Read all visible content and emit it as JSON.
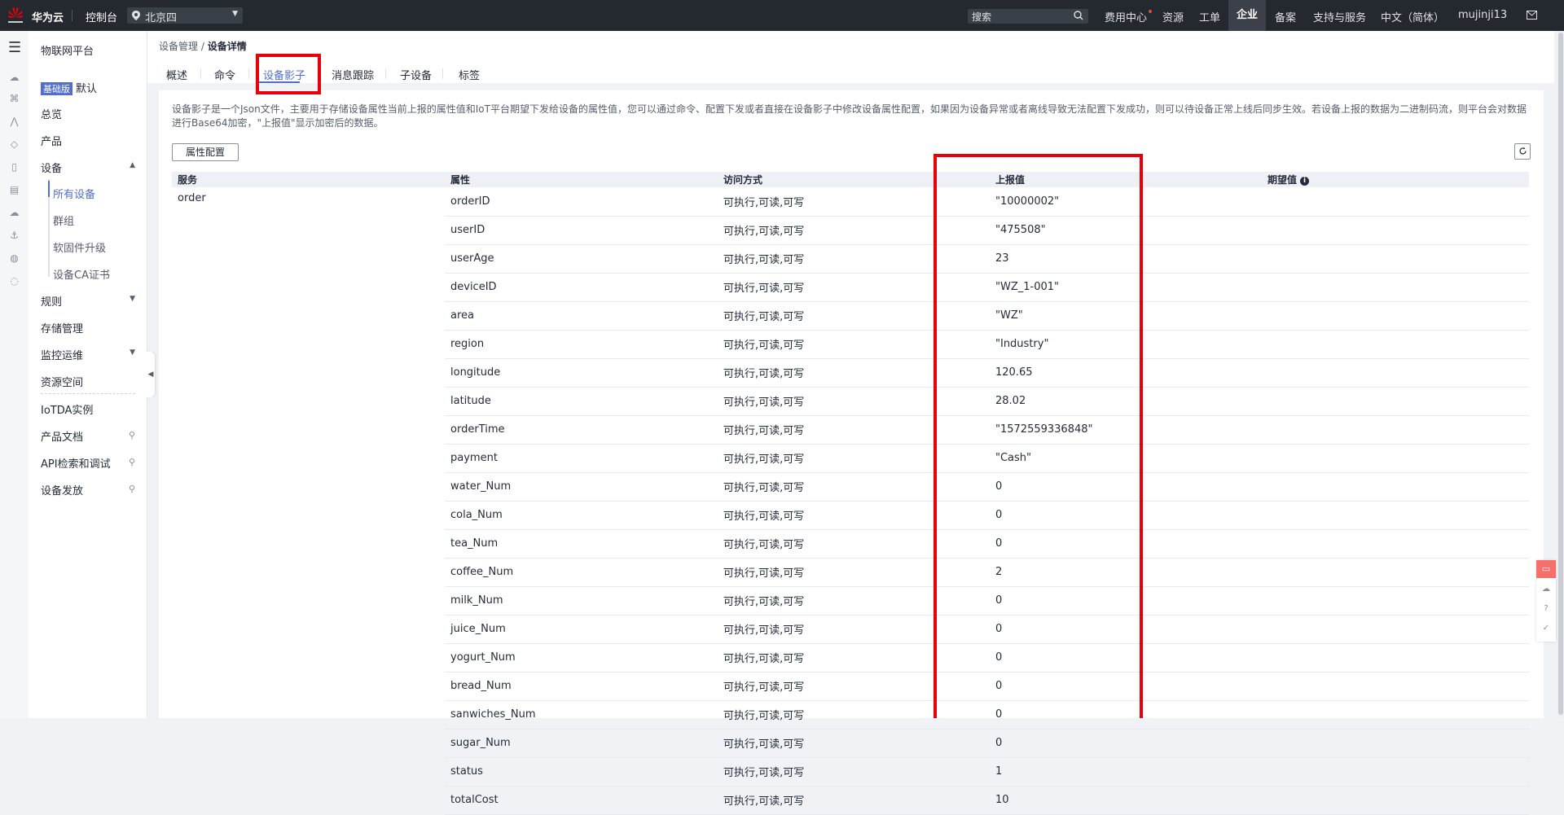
{
  "topbar": {
    "brand": "华为云",
    "console": "控制台",
    "region": "北京四",
    "search_placeholder": "搜索",
    "nav": [
      "费用中心",
      "资源",
      "工单",
      "企业",
      "备案",
      "支持与服务",
      "中文（简体）",
      "mujinji13"
    ],
    "active_nav": "企业"
  },
  "sidebar": {
    "title": "物联网平台",
    "edition_badge": "基础版",
    "edition_label": "默认",
    "items": [
      "总览",
      "产品",
      "设备",
      "规则",
      "存储管理",
      "监控运维",
      "资源空间",
      "IoTDA实例",
      "产品文档",
      "API检索和调试",
      "设备发放"
    ],
    "device_sub": [
      "所有设备",
      "群组",
      "软固件升级",
      "设备CA证书"
    ]
  },
  "breadcrumb": {
    "parent": "设备管理",
    "sep": " / ",
    "current": "设备详情"
  },
  "tabs": [
    "概述",
    "命令",
    "设备影子",
    "消息跟踪",
    "子设备",
    "标签"
  ],
  "active_tab": "设备影子",
  "description": "设备影子是一个Json文件，主要用于存储设备属性当前上报的属性值和IoT平台期望下发给设备的属性值，您可以通过命令、配置下发或者直接在设备影子中修改设备属性配置，如果因为设备异常或者离线导致无法配置下发成功，则可以待设备正常上线后同步生效。若设备上报的数据为二进制码流，则平台会对数据进行Base64加密，\"上报值\"显示加密后的数据。",
  "buttons": {
    "attr_config": "属性配置"
  },
  "table": {
    "headers": [
      "服务",
      "属性",
      "访问方式",
      "上报值",
      "期望值"
    ],
    "service": "order",
    "rows": [
      {
        "prop": "orderID",
        "access": "可执行,可读,可写",
        "reported": "\"10000002\""
      },
      {
        "prop": "userID",
        "access": "可执行,可读,可写",
        "reported": "\"475508\""
      },
      {
        "prop": "userAge",
        "access": "可执行,可读,可写",
        "reported": "23"
      },
      {
        "prop": "deviceID",
        "access": "可执行,可读,可写",
        "reported": "\"WZ_1-001\""
      },
      {
        "prop": "area",
        "access": "可执行,可读,可写",
        "reported": "\"WZ\""
      },
      {
        "prop": "region",
        "access": "可执行,可读,可写",
        "reported": "\"Industry\""
      },
      {
        "prop": "longitude",
        "access": "可执行,可读,可写",
        "reported": "120.65"
      },
      {
        "prop": "latitude",
        "access": "可执行,可读,可写",
        "reported": "28.02"
      },
      {
        "prop": "orderTime",
        "access": "可执行,可读,可写",
        "reported": "\"1572559336848\""
      },
      {
        "prop": "payment",
        "access": "可执行,可读,可写",
        "reported": "\"Cash\""
      },
      {
        "prop": "water_Num",
        "access": "可执行,可读,可写",
        "reported": "0"
      },
      {
        "prop": "cola_Num",
        "access": "可执行,可读,可写",
        "reported": "0"
      },
      {
        "prop": "tea_Num",
        "access": "可执行,可读,可写",
        "reported": "0"
      },
      {
        "prop": "coffee_Num",
        "access": "可执行,可读,可写",
        "reported": "2"
      },
      {
        "prop": "milk_Num",
        "access": "可执行,可读,可写",
        "reported": "0"
      },
      {
        "prop": "juice_Num",
        "access": "可执行,可读,可写",
        "reported": "0"
      },
      {
        "prop": "yogurt_Num",
        "access": "可执行,可读,可写",
        "reported": "0"
      },
      {
        "prop": "bread_Num",
        "access": "可执行,可读,可写",
        "reported": "0"
      },
      {
        "prop": "sanwiches_Num",
        "access": "可执行,可读,可写",
        "reported": "0"
      },
      {
        "prop": "sugar_Num",
        "access": "可执行,可读,可写",
        "reported": "0"
      },
      {
        "prop": "status",
        "access": "可执行,可读,可写",
        "reported": "1"
      },
      {
        "prop": "totalCost",
        "access": "可执行,可读,可写",
        "reported": "10"
      }
    ]
  },
  "colors": {
    "accent": "#526ecc",
    "highlight": "#e8000b",
    "topbar": "#24292f"
  }
}
